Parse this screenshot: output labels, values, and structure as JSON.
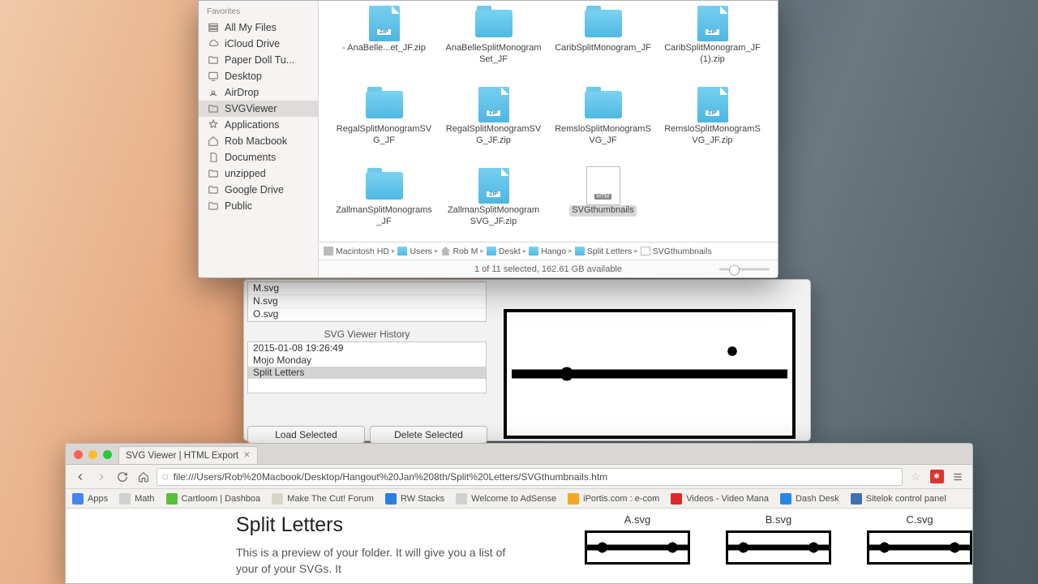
{
  "finder": {
    "sidebar": {
      "header": "Favorites",
      "items": [
        {
          "icon": "all",
          "label": "All My Files"
        },
        {
          "icon": "cloud",
          "label": "iCloud Drive"
        },
        {
          "icon": "folder",
          "label": "Paper Doll Tu..."
        },
        {
          "icon": "desktop",
          "label": "Desktop"
        },
        {
          "icon": "airdrop",
          "label": "AirDrop"
        },
        {
          "icon": "folder",
          "label": "SVGViewer",
          "sel": true
        },
        {
          "icon": "app",
          "label": "Applications"
        },
        {
          "icon": "home",
          "label": "Rob Macbook"
        },
        {
          "icon": "doc",
          "label": "Documents"
        },
        {
          "icon": "folder",
          "label": "unzipped"
        },
        {
          "icon": "folder",
          "label": "Google Drive"
        },
        {
          "icon": "folder",
          "label": "Public"
        }
      ]
    },
    "files": [
      {
        "t": "zip",
        "label": "- AnaBelle...et_JF.zip"
      },
      {
        "t": "folder",
        "label": "AnaBelleSplitMonogramSet_JF"
      },
      {
        "t": "folder",
        "label": "CaribSplitMonogram_JF"
      },
      {
        "t": "zip",
        "label": "CaribSplitMonogram_JF (1).zip"
      },
      {
        "t": "folder",
        "label": "RegalSplitMonogramSVG_JF"
      },
      {
        "t": "zip",
        "label": "RegalSplitMonogramSVG_JF.zip"
      },
      {
        "t": "folder",
        "label": "RemsloSplitMonogramSVG_JF"
      },
      {
        "t": "zip",
        "label": "RemsloSplitMonogramSVG_JF.zip"
      },
      {
        "t": "folder",
        "label": "ZallmanSplitMonograms_JF"
      },
      {
        "t": "zip",
        "label": "ZallmanSplitMonogramSVG_JF.zip"
      },
      {
        "t": "page",
        "label": "SVGthumbnails",
        "sel": true,
        "tag": "HTM"
      }
    ],
    "path": [
      {
        "icon": "hd",
        "label": "Macintosh HD"
      },
      {
        "icon": "fo",
        "label": "Users"
      },
      {
        "icon": "hm",
        "label": "Rob M"
      },
      {
        "icon": "fo",
        "label": "Deskt"
      },
      {
        "icon": "fo",
        "label": "Hango"
      },
      {
        "icon": "fo",
        "label": "Split Letters"
      },
      {
        "icon": "pg",
        "label": "SVGthumbnails"
      }
    ],
    "status": "1 of 11 selected, 162.61 GB available"
  },
  "svgviewer": {
    "filelist": [
      "M.svg",
      "N.svg",
      "O.svg"
    ],
    "history_label": "SVG Viewer History",
    "history": [
      {
        "t": "2015-01-08 19:26:49"
      },
      {
        "t": "Mojo Monday"
      },
      {
        "t": "Split Letters",
        "sel": true
      }
    ],
    "btn_load": "Load Selected",
    "btn_delete": "Delete Selected"
  },
  "chrome": {
    "tab": {
      "title": "SVG Viewer | HTML Export"
    },
    "url": "file:///Users/Rob%20Macbook/Desktop/Hangout%20Jan%208th/Split%20Letters/SVGthumbnails.htm",
    "bookmarks": [
      {
        "c": "#4285f4",
        "label": "Apps"
      },
      {
        "c": "#d0d0d0",
        "label": "Math"
      },
      {
        "c": "#5bbf3a",
        "label": "Cartloom | Dashboa"
      },
      {
        "c": "#d8d4c8",
        "label": "Make The Cut! Forum"
      },
      {
        "c": "#2a7de1",
        "label": "RW Stacks"
      },
      {
        "c": "#d0d0d0",
        "label": "Welcome to AdSense"
      },
      {
        "c": "#f5a623",
        "label": "iPortis.com : e-com"
      },
      {
        "c": "#e02828",
        "label": "Videos - Video Mana"
      },
      {
        "c": "#2588e6",
        "label": "Dash Desk"
      },
      {
        "c": "#3f6fb5",
        "label": "Sitelok control panel"
      }
    ],
    "page": {
      "title": "Split Letters",
      "desc": "This is a preview of your folder. It will give you a list of your of your SVGs. It",
      "thumbs": [
        "A.svg",
        "B.svg",
        "C.svg"
      ]
    }
  }
}
